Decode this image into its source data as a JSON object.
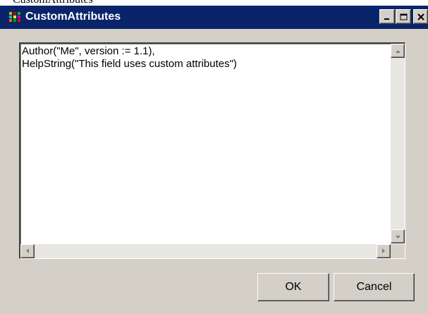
{
  "window": {
    "title": "CustomAttributes",
    "top_strip_text": "CustomAttributes"
  },
  "title_bar": {
    "icon": "app-grid-icon",
    "minimize_icon": "minimize-icon",
    "maximize_icon": "maximize-icon",
    "close_icon": "close-icon",
    "background_color": "#0a246a",
    "title_color": "#ffffff"
  },
  "editor": {
    "value": "Author(\"Me\", version := 1.1),\nHelpString(\"This field uses custom attributes\")",
    "scrollbars": {
      "up_icon": "scroll-up-arrow-icon",
      "down_icon": "scroll-down-arrow-icon",
      "left_icon": "scroll-left-arrow-icon",
      "right_icon": "scroll-right-arrow-icon"
    }
  },
  "buttons": {
    "ok_label": "OK",
    "cancel_label": "Cancel"
  },
  "colors": {
    "dialog_face": "#d4d0c8",
    "editor_background": "#ffffff"
  }
}
